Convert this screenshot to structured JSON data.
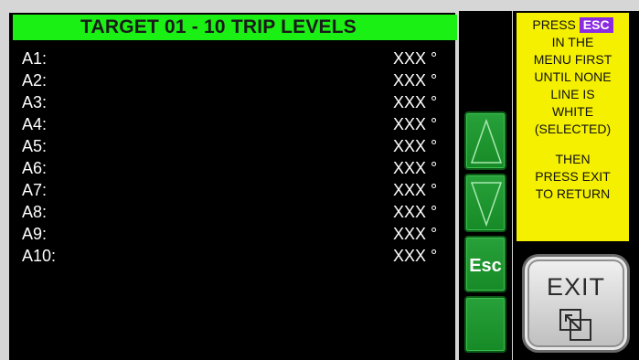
{
  "header": {
    "title": "TARGET 01 - 10 TRIP LEVELS"
  },
  "trip_levels": [
    {
      "label": "A1:",
      "value": "XXX °"
    },
    {
      "label": "A2:",
      "value": "XXX °"
    },
    {
      "label": "A3:",
      "value": "XXX °"
    },
    {
      "label": "A4:",
      "value": "XXX °"
    },
    {
      "label": "A5:",
      "value": "XXX °"
    },
    {
      "label": "A6:",
      "value": "XXX °"
    },
    {
      "label": "A7:",
      "value": "XXX °"
    },
    {
      "label": "A8:",
      "value": "XXX °"
    },
    {
      "label": "A9:",
      "value": "XXX °"
    },
    {
      "label": "A10:",
      "value": "XXX °"
    }
  ],
  "nav": {
    "up_icon": "triangle-up-icon",
    "down_icon": "triangle-down-icon",
    "esc_label": "Esc"
  },
  "help": {
    "press": "PRESS",
    "esc_chip": "ESC",
    "lines1": [
      "IN THE",
      "MENU FIRST",
      "UNTIL NONE",
      "LINE IS",
      "WHITE",
      "(SELECTED)"
    ],
    "lines2": [
      "THEN",
      "PRESS EXIT",
      "TO RETURN"
    ]
  },
  "exit": {
    "label": "EXIT",
    "icon": "window-restore-icon"
  },
  "colors": {
    "title_bg": "#1af014",
    "panel_bg": "#000000",
    "button_green": "#1e9a2e",
    "note_bg": "#f5f000",
    "esc_chip": "#8a2be2"
  }
}
